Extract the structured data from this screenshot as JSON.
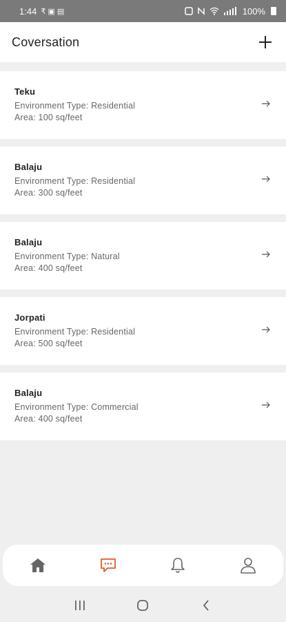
{
  "status_bar": {
    "time": "1:44",
    "glyphs_left": "₹  ▣  ▤",
    "battery_text": "100%"
  },
  "header": {
    "title": "Coversation"
  },
  "conversations": [
    {
      "name": "Teku",
      "environment": "Environment Type: Residential",
      "area": "Area: 100 sq/feet"
    },
    {
      "name": "Balaju",
      "environment": "Environment Type: Residential",
      "area": "Area: 300 sq/feet"
    },
    {
      "name": "Balaju",
      "environment": "Environment Type: Natural",
      "area": "Area: 400 sq/feet"
    },
    {
      "name": "Jorpati",
      "environment": "Environment Type: Residential",
      "area": "Area: 500 sq/feet"
    },
    {
      "name": "Balaju",
      "environment": "Environment Type: Commercial",
      "area": "Area: 400 sq/feet"
    }
  ],
  "bottom_nav": {
    "items": [
      "home-icon",
      "chat-icon",
      "bell-icon",
      "profile-icon"
    ],
    "active": "chat-icon",
    "active_color": "#e05a2b",
    "inactive_color": "#666666"
  }
}
